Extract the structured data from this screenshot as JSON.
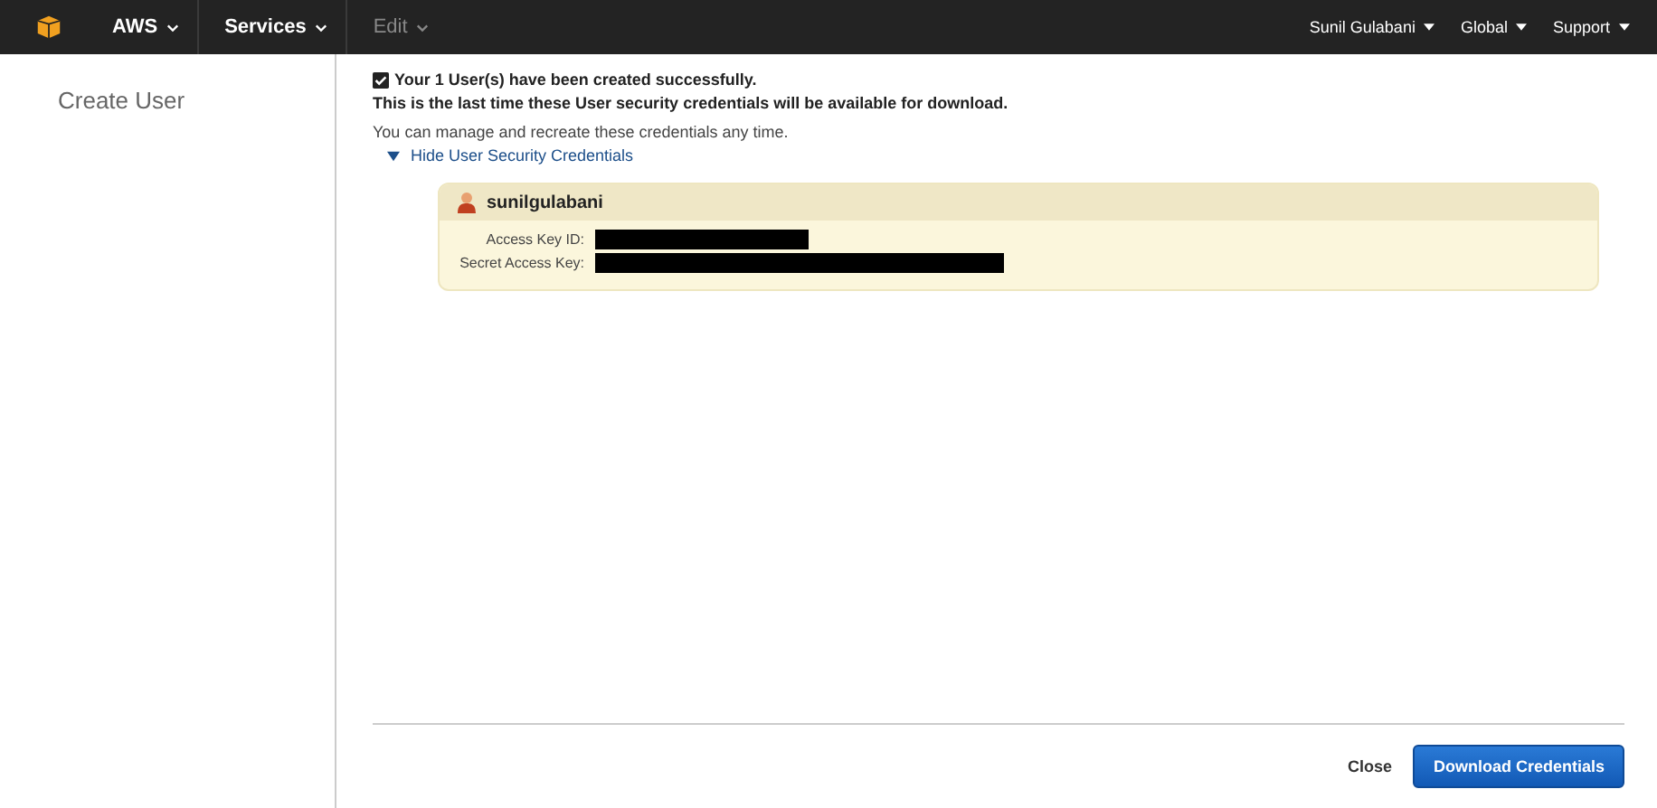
{
  "nav": {
    "left": [
      {
        "label": "AWS",
        "disabled": false
      },
      {
        "label": "Services",
        "disabled": false
      },
      {
        "label": "Edit",
        "disabled": true
      }
    ],
    "right": [
      {
        "label": "Sunil Gulabani"
      },
      {
        "label": "Global"
      },
      {
        "label": "Support"
      }
    ]
  },
  "sidebar": {
    "title": "Create User"
  },
  "message": {
    "success": "Your 1 User(s) have been created successfully.",
    "warning": "This is the last time these User security credentials will be available for download.",
    "info": "You can manage and recreate these credentials any time."
  },
  "toggle": {
    "label": "Hide User Security Credentials",
    "expanded": true
  },
  "credentials": {
    "user": "sunilgulabani",
    "fields": [
      {
        "label": "Access Key ID:"
      },
      {
        "label": "Secret Access Key:"
      }
    ]
  },
  "footer": {
    "close": "Close",
    "download": "Download Credentials"
  }
}
